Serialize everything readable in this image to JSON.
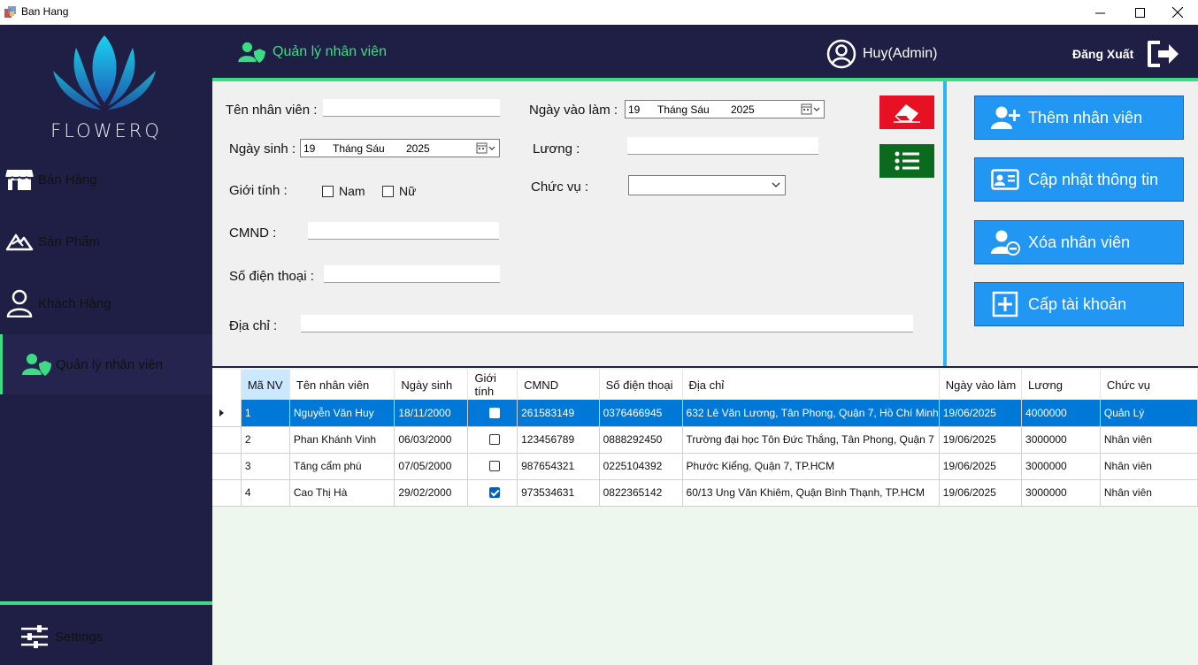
{
  "window": {
    "title": "Ban Hang"
  },
  "sidebar": {
    "brand": "FLOWERQ",
    "items": [
      {
        "label": "Bán Hàng",
        "icon": "store-icon"
      },
      {
        "label": "Sản Phẩm",
        "icon": "product-icon"
      },
      {
        "label": "Khách Hàng",
        "icon": "user-icon"
      },
      {
        "label": "Quản lý nhân viên",
        "icon": "staff-shield-icon",
        "active": true
      }
    ],
    "settings_label": "Settings"
  },
  "header": {
    "title": "Quản lý nhân viên",
    "user": "Huy(Admin)",
    "logout": "Đăng Xuất"
  },
  "form": {
    "name_label": "Tên nhân viên :",
    "name_value": "",
    "birth_label": "Ngày sinh :",
    "birth_day": "19",
    "birth_month": "Tháng Sáu",
    "birth_year": "2025",
    "gender_label": "Giới tính :",
    "gender_male": "Nam",
    "gender_female": "Nữ",
    "id_label": "CMND :",
    "id_value": "",
    "phone_label": "Số điện thoại :",
    "phone_value": "",
    "address_label": "Địa chỉ :",
    "address_value": "",
    "start_label": "Ngày vào làm :",
    "start_day": "19",
    "start_month": "Tháng Sáu",
    "start_year": "2025",
    "salary_label": "Lương :",
    "salary_value": "",
    "position_label": "Chức vụ :",
    "position_value": ""
  },
  "actions": {
    "add": "Thêm nhân viên",
    "update": "Cập nhật thông tin",
    "delete": "Xóa nhân viên",
    "grant": "Cấp tài khoản"
  },
  "colors": {
    "sidebar_bg": "#1f1f45",
    "accent_green": "#3ddc84",
    "action_blue": "#2196f3",
    "clear_red": "#e81123",
    "list_green": "#0a6b1f",
    "grid_selected": "#0078d7"
  },
  "grid": {
    "columns": [
      "Mã NV",
      "Tên nhân viên",
      "Ngày sinh",
      "Giới tính",
      "CMND",
      "Số điện thoại",
      "Địa chỉ",
      "Ngày vào làm",
      "Lương",
      "Chức vụ"
    ],
    "rows": [
      {
        "id": "1",
        "name": "Nguyễn Văn Huy",
        "dob": "18/11/2000",
        "gender": false,
        "cmnd": "261583149",
        "phone": "0376466945",
        "address": "632 Lê Văn Lương, Tân Phong, Quận 7, Hồ Chí Minh",
        "start": "19/06/2025",
        "salary": "4000000",
        "position": "Quản Lý"
      },
      {
        "id": "2",
        "name": "Phan Khánh Vinh",
        "dob": "06/03/2000",
        "gender": false,
        "cmnd": "123456789",
        "phone": "0888292450",
        "address": "Trường đại học Tôn Đức Thắng, Tân Phong, Quận 7",
        "start": "19/06/2025",
        "salary": "3000000",
        "position": "Nhân viên"
      },
      {
        "id": "3",
        "name": "Tăng cẩm phú",
        "dob": "07/05/2000",
        "gender": false,
        "cmnd": "987654321",
        "phone": "0225104392",
        "address": "Phước Kiểng, Quận 7, TP.HCM",
        "start": "19/06/2025",
        "salary": "3000000",
        "position": "Nhân viên"
      },
      {
        "id": "4",
        "name": "Cao Thị Hà",
        "dob": "29/02/2000",
        "gender": true,
        "cmnd": "973534631",
        "phone": "0822365142",
        "address": "60/13 Ung Văn Khiêm, Quận Bình Thạnh, TP.HCM",
        "start": "19/06/2025",
        "salary": "3000000",
        "position": "Nhân viên"
      }
    ]
  }
}
